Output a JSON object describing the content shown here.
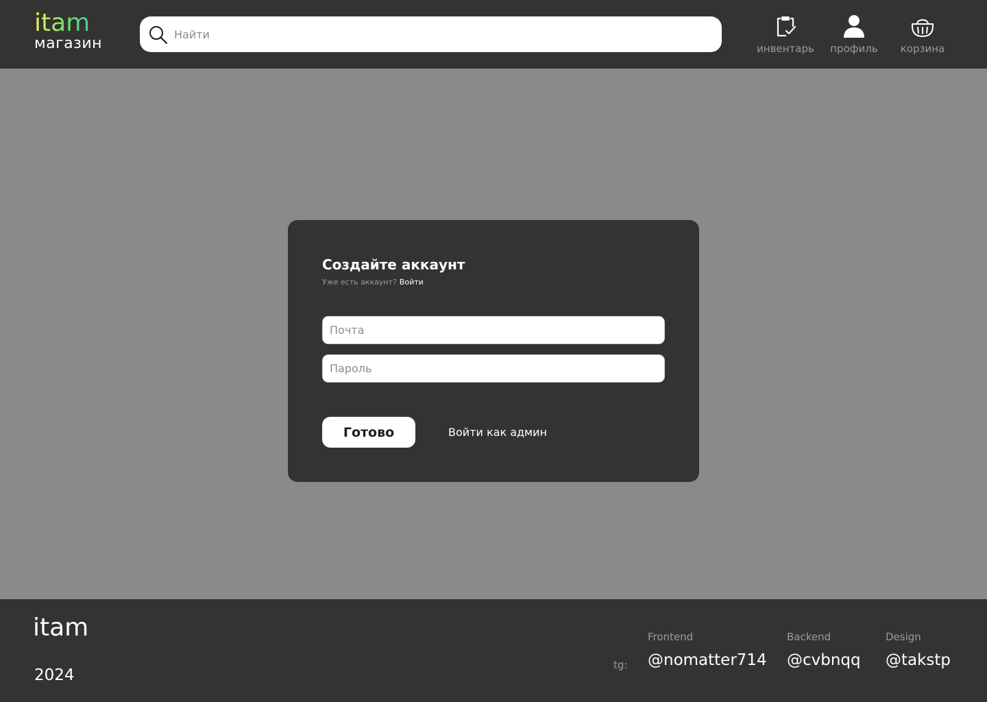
{
  "header": {
    "logo_word": "itam",
    "logo_sub": "магазин",
    "search_placeholder": "Найти",
    "nav": [
      {
        "label": "инвентарь",
        "icon": "clipboard-check-icon"
      },
      {
        "label": "профиль",
        "icon": "user-icon"
      },
      {
        "label": "корзина",
        "icon": "basket-icon"
      }
    ]
  },
  "form": {
    "title": "Создайте аккаунт",
    "have_account": "Уже есть аккаунт?",
    "login_link": "Войти",
    "email_placeholder": "Почта",
    "password_placeholder": "Пароль",
    "submit_label": "Готово",
    "admin_link": "Войти как админ"
  },
  "footer": {
    "logo": "itam",
    "year": "2024",
    "tg_label": "tg:",
    "contacts": [
      {
        "role": "Frontend",
        "handle": "@nomatter714"
      },
      {
        "role": "Backend",
        "handle": "@cvbnqq"
      },
      {
        "role": "Design",
        "handle": "@takstp"
      }
    ]
  },
  "colors": {
    "header_bg": "#353331",
    "page_bg": "#8a8a8a",
    "card_bg": "#353331",
    "logo_gradient": [
      "#f0ef5a",
      "#6de06a",
      "#25b4e6"
    ]
  }
}
